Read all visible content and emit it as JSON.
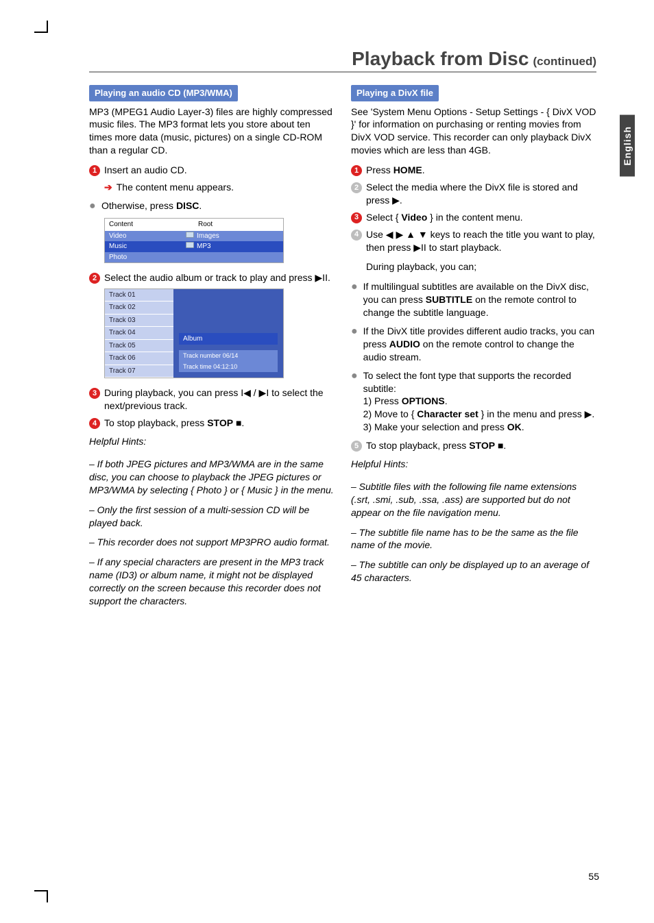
{
  "header": {
    "title": "Playback from Disc",
    "sub": "(continued)"
  },
  "side_tab": "English",
  "page_number": "55",
  "left": {
    "section_bar": "Playing an audio CD (MP3/WMA)",
    "intro": "MP3 (MPEG1 Audio Layer-3) files are highly compressed music files.  The MP3 format lets you store about ten times more data (music, pictures) on a single CD-ROM than a regular CD.",
    "step1": "Insert an audio CD.",
    "step1_sub": "The content menu appears.",
    "bullet_otherwise_pre": "Otherwise, press ",
    "bullet_otherwise_bold": "DISC",
    "shot1": {
      "head_left": "Content",
      "head_right": "Root",
      "r1l": "Video",
      "r1r": "Images",
      "r2l": "Music",
      "r2r": "MP3",
      "r3l": "Photo"
    },
    "step2_pre": "Select the audio album or track to play and press ",
    "shot2": {
      "tracks": [
        "Track 01",
        "Track 02",
        "Track 03",
        "Track 04",
        "Track 05",
        "Track 06",
        "Track 07"
      ],
      "album": "Album",
      "tnum": "Track number  06/14",
      "ttime": "Track time   04:12:10"
    },
    "step3_pre": "During playback, you can press ",
    "step3_post": " to select the next/previous track.",
    "step4_pre": "To stop playback, press ",
    "step4_bold": "STOP",
    "hints_title": "Helpful Hints:",
    "hint1": "–  If both JPEG pictures and MP3/WMA are in the same disc, you can choose to playback the JPEG pictures or MP3/WMA by selecting { Photo } or { Music } in the menu.",
    "hint2": "–  Only the first session of a multi-session CD will be played back.",
    "hint3": "–  This recorder does not support MP3PRO audio format.",
    "hint4": "–  If any special characters are present in the MP3 track name (ID3) or album name, it might not be displayed correctly on the screen because this recorder does not support the characters."
  },
  "right": {
    "section_bar": "Playing a DivX file",
    "intro": "See 'System Menu Options - Setup Settings - { DivX VOD }' for information on purchasing or renting movies from DivX VOD service. This recorder can only playback DivX movies which are less than 4GB.",
    "step1_pre": "Press ",
    "step1_bold": "HOME",
    "step2": "Select the media where the DivX file is stored and press ▶.",
    "step3_pre": "Select { ",
    "step3_bold": "Video",
    "step3_post": " } in the content menu.",
    "step4_pre": "Use ◀ ▶ ▲ ▼ keys to reach the title you want to play, then press ",
    "step4_post": " to start playback.",
    "during": "During playback, you can;",
    "b1_pre": "If multilingual subtitles are available on the DivX disc, you can press ",
    "b1_bold": "SUBTITLE",
    "b1_post": " on the remote control to change the subtitle language.",
    "b2_pre": "If the DivX title provides different audio tracks, you can press ",
    "b2_bold": "AUDIO",
    "b2_post": " on the remote control to change the audio stream.",
    "b3_intro": "To select the font type that supports the recorded subtitle:",
    "b3_1_pre": "1)  Press ",
    "b3_1_bold": "OPTIONS",
    "b3_2_pre": "2)  Move to { ",
    "b3_2_bold": "Character set",
    "b3_2_post": " } in the menu and press ▶.",
    "b3_3_pre": "3)  Make your selection and press ",
    "b3_3_bold": "OK",
    "step5_pre": "To stop playback, press ",
    "step5_bold": "STOP",
    "hints_title": "Helpful Hints:",
    "hint1": "–  Subtitle files with the following file name extensions (.srt, .smi, .sub, .ssa, .ass) are supported but do not appear on the file navigation menu.",
    "hint2": "–  The subtitle file name has to be the same as the file name of the movie.",
    "hint3": "–  The subtitle can only be displayed up to an average of 45 characters."
  }
}
